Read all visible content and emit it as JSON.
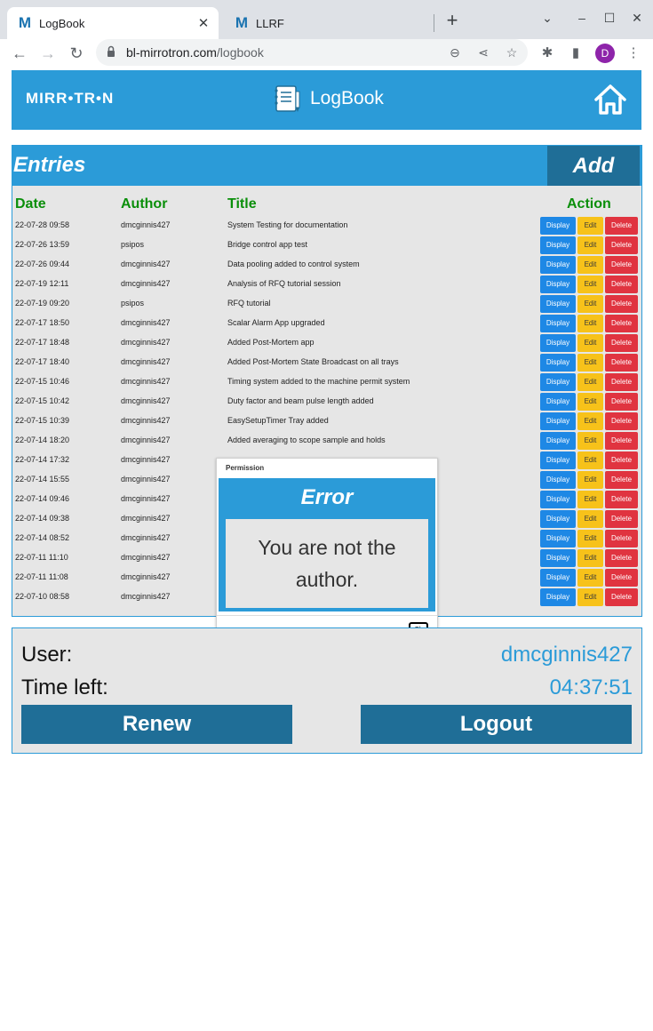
{
  "browser": {
    "tabs": [
      {
        "title": "LogBook",
        "favicon": "M"
      },
      {
        "title": "LLRF",
        "favicon": "M"
      }
    ],
    "url_host": "bl-mirrotron.com",
    "url_path": "/logbook",
    "profile_initial": "D"
  },
  "header": {
    "logo": "MIRR•TR•N",
    "title": "LogBook"
  },
  "entries": {
    "title": "Entries",
    "add_label": "Add",
    "columns": {
      "date": "Date",
      "author": "Author",
      "title": "Title",
      "action": "Action"
    },
    "buttons": {
      "display": "Display",
      "edit": "Edit",
      "delete": "Delete"
    },
    "rows": [
      {
        "date": "22-07-28 09:58",
        "author": "dmcginnis427",
        "title": "System Testing for documentation"
      },
      {
        "date": "22-07-26 13:59",
        "author": "psipos",
        "title": "Bridge control app test"
      },
      {
        "date": "22-07-26 09:44",
        "author": "dmcginnis427",
        "title": "Data pooling added to control system"
      },
      {
        "date": "22-07-19 12:11",
        "author": "dmcginnis427",
        "title": "Analysis of RFQ tutorial session"
      },
      {
        "date": "22-07-19 09:20",
        "author": "psipos",
        "title": "RFQ tutorial"
      },
      {
        "date": "22-07-17 18:50",
        "author": "dmcginnis427",
        "title": "Scalar Alarm App upgraded"
      },
      {
        "date": "22-07-17 18:48",
        "author": "dmcginnis427",
        "title": "Added Post-Mortem app"
      },
      {
        "date": "22-07-17 18:40",
        "author": "dmcginnis427",
        "title": "Added Post-Mortem State Broadcast on all trays"
      },
      {
        "date": "22-07-15 10:46",
        "author": "dmcginnis427",
        "title": "Timing system added to the machine permit system"
      },
      {
        "date": "22-07-15 10:42",
        "author": "dmcginnis427",
        "title": "Duty factor and beam pulse length added"
      },
      {
        "date": "22-07-15 10:39",
        "author": "dmcginnis427",
        "title": "EasySetupTimer Tray added"
      },
      {
        "date": "22-07-14 18:20",
        "author": "dmcginnis427",
        "title": "Added averaging to scope sample and holds"
      },
      {
        "date": "22-07-14 17:32",
        "author": "dmcginnis427",
        "title": ""
      },
      {
        "date": "22-07-14 15:55",
        "author": "dmcginnis427",
        "title": ""
      },
      {
        "date": "22-07-14 09:46",
        "author": "dmcginnis427",
        "title": ""
      },
      {
        "date": "22-07-14 09:38",
        "author": "dmcginnis427",
        "title": ""
      },
      {
        "date": "22-07-14 08:52",
        "author": "dmcginnis427",
        "title": ""
      },
      {
        "date": "22-07-11 11:10",
        "author": "dmcginnis427",
        "title": ""
      },
      {
        "date": "22-07-11 11:08",
        "author": "dmcginnis427",
        "title": ""
      },
      {
        "date": "22-07-10 08:58",
        "author": "dmcginnis427",
        "title": ""
      }
    ]
  },
  "modal": {
    "title": "Permission",
    "heading": "Error",
    "message": "You are not the author.",
    "ok_label": "Ok"
  },
  "user_panel": {
    "user_label": "User:",
    "user_value": "dmcginnis427",
    "time_label": "Time left:",
    "time_value": "04:37:51",
    "renew_label": "Renew",
    "logout_label": "Logout"
  },
  "colors": {
    "accent": "#2b9bd8",
    "button_dark": "#1f6e97",
    "header_green": "#0a8f0a",
    "display_btn": "#1e88e5",
    "edit_btn": "#f7c21a",
    "delete_btn": "#e03440"
  }
}
